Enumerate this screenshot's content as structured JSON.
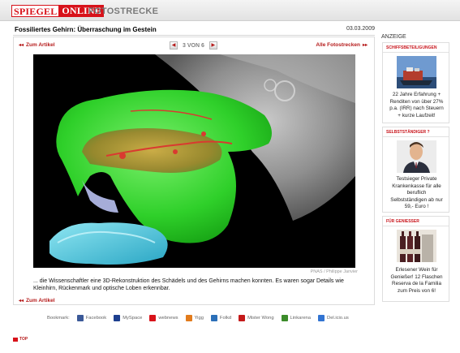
{
  "header": {
    "logo_part1": "SPIEGEL",
    "logo_part2": "ONLINE",
    "section": "FOTOSTRECKE"
  },
  "gallery": {
    "title": "Fossiliertes Gehirn: Überraschung im Gestein",
    "date": "03.03.2009",
    "back_label": "Zum Artikel",
    "all_label": "Alle Fotostrecken",
    "pager_count": "3 VON 6",
    "credit": "PNAS / Philippe Janvier",
    "caption": "... die Wissenschaftler eine 3D-Rekonstruktion des Schädels und des Gehirns machen konnten. Es waren sogar Details wie Kleinhirn, Rückenmark und optische Loben erkennbar.",
    "back_label_bottom": "Zum Artikel"
  },
  "bookmarks": {
    "label": "Bookmark:",
    "items": [
      {
        "label": "Facebook",
        "icon": "facebook-icon",
        "color": "#3b5998"
      },
      {
        "label": "MySpace",
        "icon": "myspace-icon",
        "color": "#1d3f8f"
      },
      {
        "label": "webnews",
        "icon": "webnews-icon",
        "color": "#d8121a"
      },
      {
        "label": "Yigg",
        "icon": "yigg-icon",
        "color": "#e27b1c"
      },
      {
        "label": "Folkd",
        "icon": "folkd-icon",
        "color": "#2c6fb8"
      },
      {
        "label": "Mister Wong",
        "icon": "misterwong-icon",
        "color": "#c41a1a"
      },
      {
        "label": "Linkarena",
        "icon": "linkarena-icon",
        "color": "#3c8c2a"
      },
      {
        "label": "Del.icio.us",
        "icon": "delicious-icon",
        "color": "#3274d2"
      }
    ]
  },
  "top_link": "TOP",
  "sidebar": {
    "label": "ANZEIGE",
    "ads": [
      {
        "heading": "SCHIFFSBETEILIGUNGEN",
        "lines": [
          "22 Jahre Erfahrung +",
          "Renditen von über 27%",
          "p.a. (IRR) nach Steuern",
          "+ kurze Laufzeit!"
        ],
        "image": "ship-image"
      },
      {
        "heading": "SELBSTSTÄNDIGER ?",
        "lines": [
          "Testsieger Private",
          "Krankenkasse für alle",
          "beruflich",
          "Selbstständigen ab nur",
          "59,- Euro !"
        ],
        "image": "businessman-image"
      },
      {
        "heading": "FÜR GENIESSER",
        "lines": [
          "Erlesener Wein für",
          "Genießer! 12 Flaschen",
          "Reserva de la Familia",
          "zum Preis von 6!"
        ],
        "image": "wine-image"
      }
    ]
  },
  "colors": {
    "brand_red": "#d8121a",
    "link_red": "#b51a1a"
  }
}
